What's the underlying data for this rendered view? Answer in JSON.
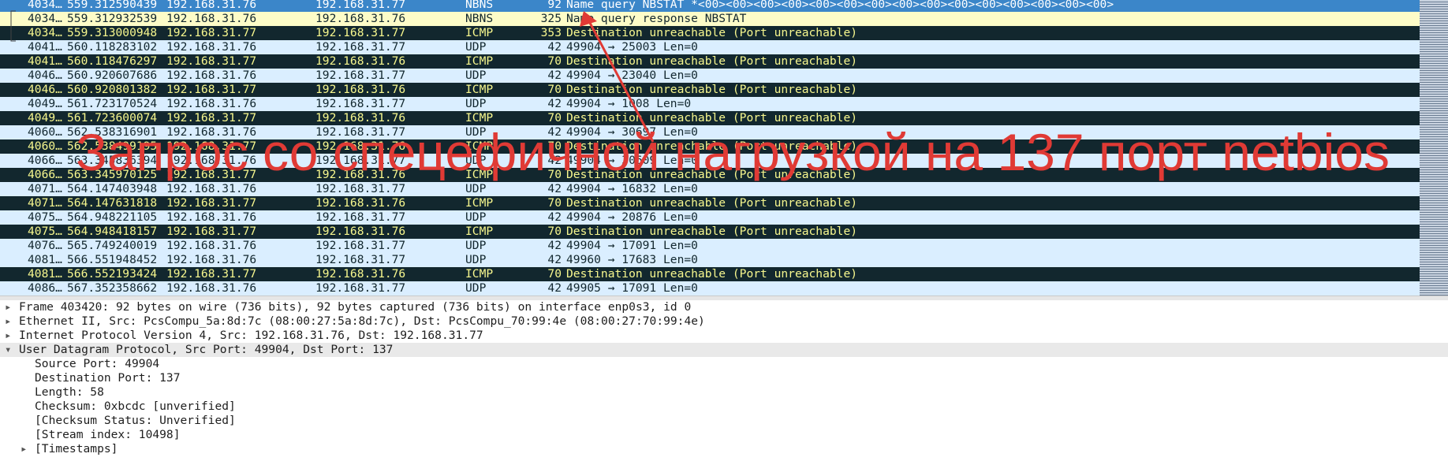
{
  "packets": [
    {
      "no": "4034…",
      "time": "559.312590439",
      "src": "192.168.31.76",
      "dst": "192.168.31.77",
      "proto": "NBNS",
      "len": "92",
      "info": "Name query NBSTAT *<00><00><00><00><00><00><00><00><00><00><00><00><00><00><00>",
      "kind": "sel"
    },
    {
      "no": "4034…",
      "time": "559.312932539",
      "src": "192.168.31.76",
      "dst": "192.168.31.76",
      "proto": "NBNS",
      "len": "325",
      "info": "Name query response NBSTAT",
      "kind": "nbns"
    },
    {
      "no": "4034…",
      "time": "559.313000948",
      "src": "192.168.31.77",
      "dst": "192.168.31.77",
      "proto": "ICMP",
      "len": "353",
      "info": "Destination unreachable (Port unreachable)",
      "kind": "icmp"
    },
    {
      "no": "4041…",
      "time": "560.118283102",
      "src": "192.168.31.76",
      "dst": "192.168.31.77",
      "proto": "UDP",
      "len": "42",
      "info": "49904 → 25003 Len=0",
      "kind": "udp"
    },
    {
      "no": "4041…",
      "time": "560.118476297",
      "src": "192.168.31.77",
      "dst": "192.168.31.76",
      "proto": "ICMP",
      "len": "70",
      "info": "Destination unreachable (Port unreachable)",
      "kind": "icmp"
    },
    {
      "no": "4046…",
      "time": "560.920607686",
      "src": "192.168.31.76",
      "dst": "192.168.31.77",
      "proto": "UDP",
      "len": "42",
      "info": "49904 → 23040 Len=0",
      "kind": "udp"
    },
    {
      "no": "4046…",
      "time": "560.920801382",
      "src": "192.168.31.77",
      "dst": "192.168.31.76",
      "proto": "ICMP",
      "len": "70",
      "info": "Destination unreachable (Port unreachable)",
      "kind": "icmp"
    },
    {
      "no": "4049…",
      "time": "561.723170524",
      "src": "192.168.31.76",
      "dst": "192.168.31.77",
      "proto": "UDP",
      "len": "42",
      "info": "49904 → 1008 Len=0",
      "kind": "udp"
    },
    {
      "no": "4049…",
      "time": "561.723600074",
      "src": "192.168.31.77",
      "dst": "192.168.31.76",
      "proto": "ICMP",
      "len": "70",
      "info": "Destination unreachable (Port unreachable)",
      "kind": "icmp"
    },
    {
      "no": "4060…",
      "time": "562.538316901",
      "src": "192.168.31.76",
      "dst": "192.168.31.77",
      "proto": "UDP",
      "len": "42",
      "info": "49904 → 30697 Len=0",
      "kind": "udp"
    },
    {
      "no": "4060…",
      "time": "562.538499195",
      "src": "192.168.31.77",
      "dst": "192.168.31.76",
      "proto": "ICMP",
      "len": "70",
      "info": "Destination unreachable (Port unreachable)",
      "kind": "icmp"
    },
    {
      "no": "4066…",
      "time": "563.345836394",
      "src": "192.168.31.76",
      "dst": "192.168.31.77",
      "proto": "UDP",
      "len": "42",
      "info": "49904 → 30609 Len=0",
      "kind": "udp"
    },
    {
      "no": "4066…",
      "time": "563.345970125",
      "src": "192.168.31.77",
      "dst": "192.168.31.76",
      "proto": "ICMP",
      "len": "70",
      "info": "Destination unreachable (Port unreachable)",
      "kind": "icmp"
    },
    {
      "no": "4071…",
      "time": "564.147403948",
      "src": "192.168.31.76",
      "dst": "192.168.31.77",
      "proto": "UDP",
      "len": "42",
      "info": "49904 → 16832 Len=0",
      "kind": "udp"
    },
    {
      "no": "4071…",
      "time": "564.147631818",
      "src": "192.168.31.77",
      "dst": "192.168.31.76",
      "proto": "ICMP",
      "len": "70",
      "info": "Destination unreachable (Port unreachable)",
      "kind": "icmp"
    },
    {
      "no": "4075…",
      "time": "564.948221105",
      "src": "192.168.31.76",
      "dst": "192.168.31.77",
      "proto": "UDP",
      "len": "42",
      "info": "49904 → 20876 Len=0",
      "kind": "udp"
    },
    {
      "no": "4075…",
      "time": "564.948418157",
      "src": "192.168.31.77",
      "dst": "192.168.31.76",
      "proto": "ICMP",
      "len": "70",
      "info": "Destination unreachable (Port unreachable)",
      "kind": "icmp"
    },
    {
      "no": "4076…",
      "time": "565.749240019",
      "src": "192.168.31.76",
      "dst": "192.168.31.77",
      "proto": "UDP",
      "len": "42",
      "info": "49904 → 17091 Len=0",
      "kind": "udp"
    },
    {
      "no": "4081…",
      "time": "566.551948452",
      "src": "192.168.31.76",
      "dst": "192.168.31.77",
      "proto": "UDP",
      "len": "42",
      "info": "49960 → 17683 Len=0",
      "kind": "udp"
    },
    {
      "no": "4081…",
      "time": "566.552193424",
      "src": "192.168.31.77",
      "dst": "192.168.31.76",
      "proto": "ICMP",
      "len": "70",
      "info": "Destination unreachable (Port unreachable)",
      "kind": "icmp"
    },
    {
      "no": "4086…",
      "time": "567.352358662",
      "src": "192.168.31.76",
      "dst": "192.168.31.77",
      "proto": "UDP",
      "len": "42",
      "info": "49905 → 17091 Len=0",
      "kind": "udp"
    }
  ],
  "details": [
    {
      "text": "Frame 403420: 92 bytes on wire (736 bits), 92 bytes captured (736 bits) on interface enp0s3, id 0",
      "level": 0,
      "expander": "collapsed",
      "hl": false
    },
    {
      "text": "Ethernet II, Src: PcsCompu_5a:8d:7c (08:00:27:5a:8d:7c), Dst: PcsCompu_70:99:4e (08:00:27:70:99:4e)",
      "level": 0,
      "expander": "collapsed",
      "hl": false
    },
    {
      "text": "Internet Protocol Version 4, Src: 192.168.31.76, Dst: 192.168.31.77",
      "level": 0,
      "expander": "collapsed",
      "hl": false
    },
    {
      "text": "User Datagram Protocol, Src Port: 49904, Dst Port: 137",
      "level": 0,
      "expander": "expanded",
      "hl": true
    },
    {
      "text": "Source Port: 49904",
      "level": 1,
      "expander": "none",
      "hl": false
    },
    {
      "text": "Destination Port: 137",
      "level": 1,
      "expander": "none",
      "hl": false
    },
    {
      "text": "Length: 58",
      "level": 1,
      "expander": "none",
      "hl": false
    },
    {
      "text": "Checksum: 0xbcdc [unverified]",
      "level": 1,
      "expander": "none",
      "hl": false
    },
    {
      "text": "[Checksum Status: Unverified]",
      "level": 1,
      "expander": "none",
      "hl": false
    },
    {
      "text": "[Stream index: 10498]",
      "level": 1,
      "expander": "none",
      "hl": false
    },
    {
      "text": "[Timestamps]",
      "level": 1,
      "expander": "collapsed",
      "hl": false
    }
  ],
  "annotation": {
    "text": "Запрос со спецефичной нагрузкой на 137 порт netbios",
    "color": "#e03a35"
  },
  "colors": {
    "udp_bg": "#daeeff",
    "icmp_bg": "#12272e",
    "icmp_fg": "#f7f78e",
    "nbns_bg": "#fdfcc8",
    "selected_bg": "#3b86c9"
  },
  "icons": {
    "collapsed": "triangle-right-icon",
    "expanded": "triangle-down-icon"
  }
}
